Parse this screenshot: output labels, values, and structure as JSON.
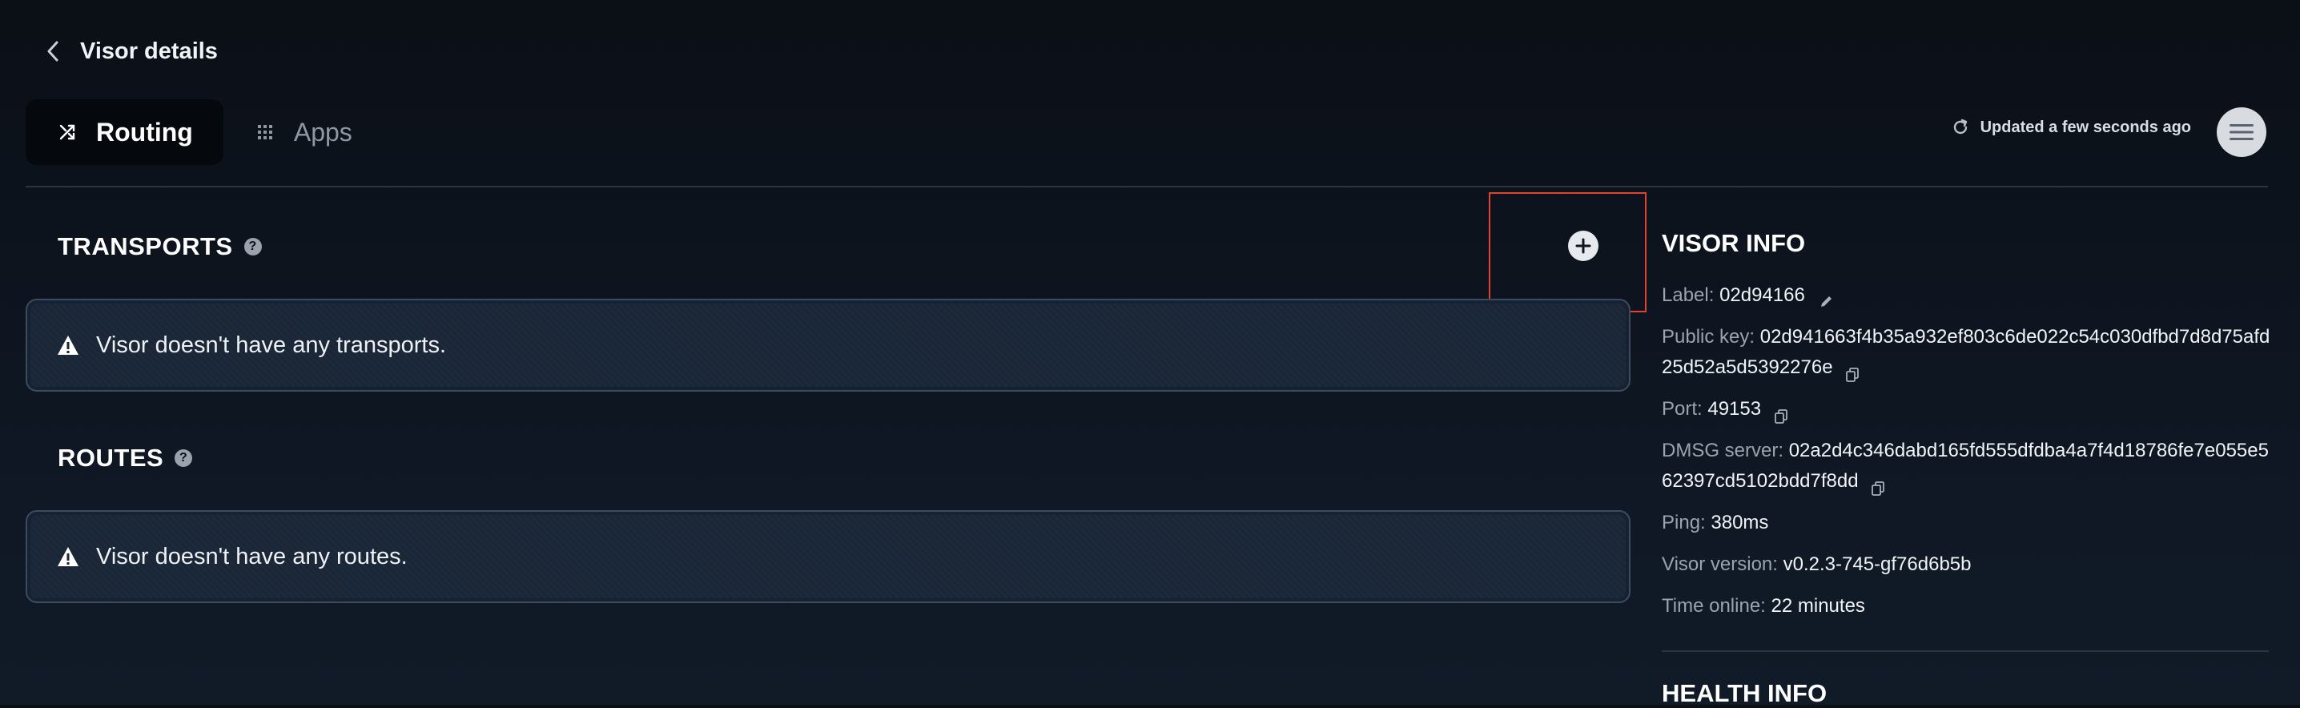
{
  "header": {
    "title": "Visor details"
  },
  "tabs": [
    {
      "label": "Routing",
      "icon": "shuffle-icon",
      "active": true
    },
    {
      "label": "Apps",
      "icon": "grid-icon",
      "active": false
    }
  ],
  "status": {
    "updated_text": "Updated a few seconds ago"
  },
  "transports": {
    "title": "TRANSPORTS",
    "empty_message": "Visor doesn't have any transports."
  },
  "routes": {
    "title": "ROUTES",
    "empty_message": "Visor doesn't have any routes."
  },
  "visor_info": {
    "title": "VISOR INFO",
    "label": {
      "key": "Label:",
      "value": "02d94166"
    },
    "public_key": {
      "key": "Public key:",
      "value": "02d941663f4b35a932ef803c6de022c54c030dfbd7d8d75afd25d52a5d5392276e"
    },
    "port": {
      "key": "Port:",
      "value": "49153"
    },
    "dmsg_server": {
      "key": "DMSG server:",
      "value": "02a2d4c346dabd165fd555dfdba4a7f4d18786fe7e055e562397cd5102bdd7f8dd"
    },
    "ping": {
      "key": "Ping:",
      "value": "380ms"
    },
    "visor_version": {
      "key": "Visor version:",
      "value": "v0.2.3-745-gf76d6b5b"
    },
    "time_online": {
      "key": "Time online:",
      "value": "22 minutes"
    }
  },
  "health_info": {
    "title": "HEALTH INFO"
  },
  "colors": {
    "background": "#0b0f16",
    "highlight": "#e2432e",
    "text": "#e8edf3",
    "muted": "#9aa3ae"
  }
}
